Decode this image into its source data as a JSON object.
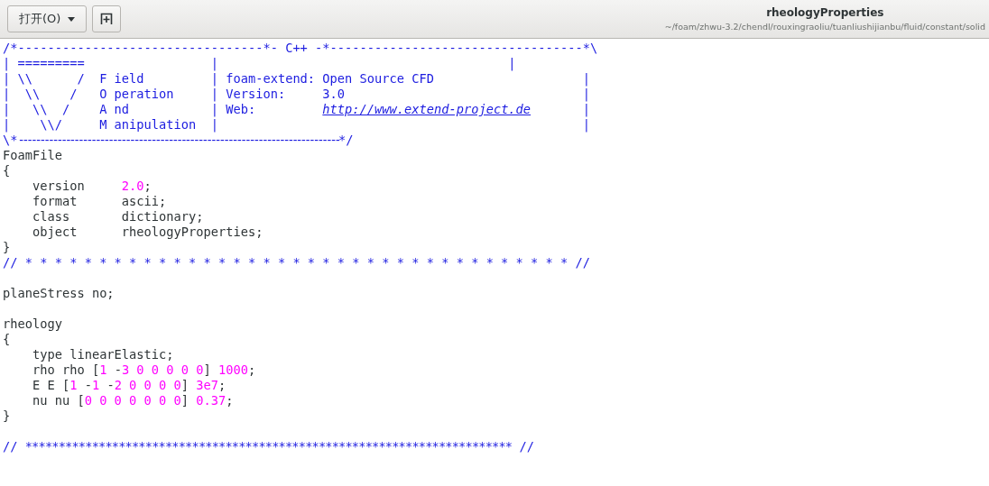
{
  "toolbar": {
    "open_button": {
      "label": "打开(O)"
    }
  },
  "window": {
    "title": "rheologyProperties",
    "subtitle": "~/foam/zhwu-3.2/chendl/rouxingraoliu/tuanliushijianbu/fluid/constant/solid"
  },
  "editor": {
    "lines": [
      {
        "kind": "code",
        "tokens": [
          {
            "kind": "comment",
            "text": "/*---------------------------------*- C++ -*----------------------------------*\\"
          }
        ]
      },
      {
        "kind": "code",
        "tokens": [
          {
            "kind": "comment",
            "text": "| =========                 |                                       |"
          }
        ]
      },
      {
        "kind": "code",
        "tokens": [
          {
            "kind": "comment",
            "text": "| \\\\      /  F ield         | foam-extend: Open Source CFD                    |"
          }
        ]
      },
      {
        "kind": "code",
        "tokens": [
          {
            "kind": "comment",
            "text": "|  \\\\    /   O peration     | Version:     3.0                                |"
          }
        ]
      },
      {
        "kind": "code",
        "tokens": [
          {
            "kind": "comment",
            "text": "|   \\\\  /    A nd           | Web:         "
          },
          {
            "kind": "link",
            "text": "http://www.extend-project.de"
          },
          {
            "kind": "comment",
            "text": "       |"
          }
        ]
      },
      {
        "kind": "code",
        "tokens": [
          {
            "kind": "comment",
            "text": "|    \\\\/     M anipulation  |                                                 |"
          }
        ]
      },
      {
        "kind": "code",
        "tokens": [
          {
            "kind": "comment",
            "text": "\\*"
          },
          {
            "kind": "rule",
            "text": "---------------------------------------------------------------------------"
          },
          {
            "kind": "comment",
            "text": "*/"
          }
        ]
      },
      {
        "kind": "code",
        "tokens": [
          {
            "kind": "plain",
            "text": "FoamFile"
          }
        ]
      },
      {
        "kind": "code",
        "tokens": [
          {
            "kind": "plain",
            "text": "{"
          }
        ]
      },
      {
        "kind": "code",
        "tokens": [
          {
            "kind": "plain",
            "text": "    version     "
          },
          {
            "kind": "number",
            "text": "2.0"
          },
          {
            "kind": "plain",
            "text": ";"
          }
        ]
      },
      {
        "kind": "code",
        "tokens": [
          {
            "kind": "plain",
            "text": "    format      ascii;"
          }
        ]
      },
      {
        "kind": "code",
        "tokens": [
          {
            "kind": "plain",
            "text": "    class       dictionary;"
          }
        ]
      },
      {
        "kind": "code",
        "tokens": [
          {
            "kind": "plain",
            "text": "    object      rheologyProperties;"
          }
        ]
      },
      {
        "kind": "code",
        "tokens": [
          {
            "kind": "plain",
            "text": "}"
          }
        ]
      },
      {
        "kind": "code",
        "tokens": [
          {
            "kind": "comment",
            "text": "// * * * * * * * * * * * * * * * * * * * * * * * * * * * * * * * * * * * * * //"
          }
        ]
      },
      {
        "kind": "blank"
      },
      {
        "kind": "code",
        "tokens": [
          {
            "kind": "plain",
            "text": "planeStress no;"
          }
        ]
      },
      {
        "kind": "blank"
      },
      {
        "kind": "code",
        "tokens": [
          {
            "kind": "plain",
            "text": "rheology"
          }
        ]
      },
      {
        "kind": "code",
        "tokens": [
          {
            "kind": "plain",
            "text": "{"
          }
        ]
      },
      {
        "kind": "code",
        "tokens": [
          {
            "kind": "plain",
            "text": "    type linearElastic;"
          }
        ]
      },
      {
        "kind": "code",
        "tokens": [
          {
            "kind": "plain",
            "text": "    rho rho ["
          },
          {
            "kind": "number",
            "text": "1"
          },
          {
            "kind": "plain",
            "text": " -"
          },
          {
            "kind": "number",
            "text": "3 0 0 0 0 0"
          },
          {
            "kind": "plain",
            "text": "] "
          },
          {
            "kind": "number",
            "text": "1000"
          },
          {
            "kind": "plain",
            "text": ";"
          }
        ]
      },
      {
        "kind": "code",
        "tokens": [
          {
            "kind": "plain",
            "text": "    E E ["
          },
          {
            "kind": "number",
            "text": "1"
          },
          {
            "kind": "plain",
            "text": " -"
          },
          {
            "kind": "number",
            "text": "1"
          },
          {
            "kind": "plain",
            "text": " -"
          },
          {
            "kind": "number",
            "text": "2 0 0 0 0"
          },
          {
            "kind": "plain",
            "text": "] "
          },
          {
            "kind": "number",
            "text": "3e7"
          },
          {
            "kind": "plain",
            "text": ";"
          }
        ]
      },
      {
        "kind": "code",
        "tokens": [
          {
            "kind": "plain",
            "text": "    nu nu ["
          },
          {
            "kind": "number",
            "text": "0 0 0 0 0 0 0"
          },
          {
            "kind": "plain",
            "text": "] "
          },
          {
            "kind": "number",
            "text": "0.37"
          },
          {
            "kind": "plain",
            "text": ";"
          }
        ]
      },
      {
        "kind": "code",
        "tokens": [
          {
            "kind": "plain",
            "text": "}"
          }
        ]
      },
      {
        "kind": "blank"
      },
      {
        "kind": "code",
        "tokens": [
          {
            "kind": "comment",
            "text": "// "
          },
          {
            "kind": "stars",
            "text": "*************************************************************************"
          },
          {
            "kind": "comment",
            "text": " //"
          }
        ]
      }
    ]
  }
}
